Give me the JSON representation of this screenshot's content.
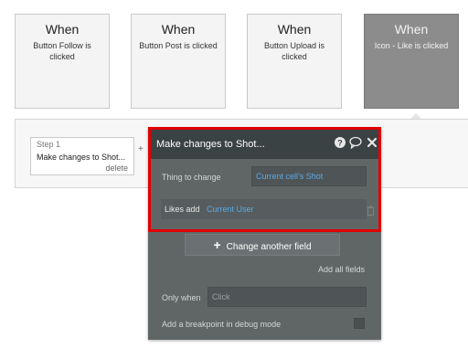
{
  "events": [
    {
      "title": "When",
      "subtitle": "Button Follow is clicked",
      "selected": false
    },
    {
      "title": "When",
      "subtitle": "Button Post is clicked",
      "selected": false
    },
    {
      "title": "When",
      "subtitle": "Button Upload is clicked",
      "selected": false
    },
    {
      "title": "When",
      "subtitle": "Icon - Like is clicked",
      "selected": true
    }
  ],
  "step": {
    "number_label": "Step 1",
    "title": "Make changes to Shot...",
    "delete_label": "delete"
  },
  "panel": {
    "title": "Make changes to Shot...",
    "icons": [
      "help-icon",
      "comment-icon",
      "close-icon"
    ],
    "thing_to_change_label": "Thing to change",
    "thing_to_change_value": "Current cell's Shot",
    "field_name": "Likes add",
    "field_value": "Current User",
    "change_field_label": "Change another field",
    "add_all_fields_label": "Add all fields",
    "only_when_label": "Only when",
    "only_when_placeholder": "Click",
    "breakpoint_label": "Add a breakpoint in debug mode",
    "breakpoint_checked": false
  },
  "colors": {
    "highlight": "#e00000",
    "link": "#5aa9e6",
    "panel_bg": "#606666",
    "header_bg": "#3b4244"
  }
}
